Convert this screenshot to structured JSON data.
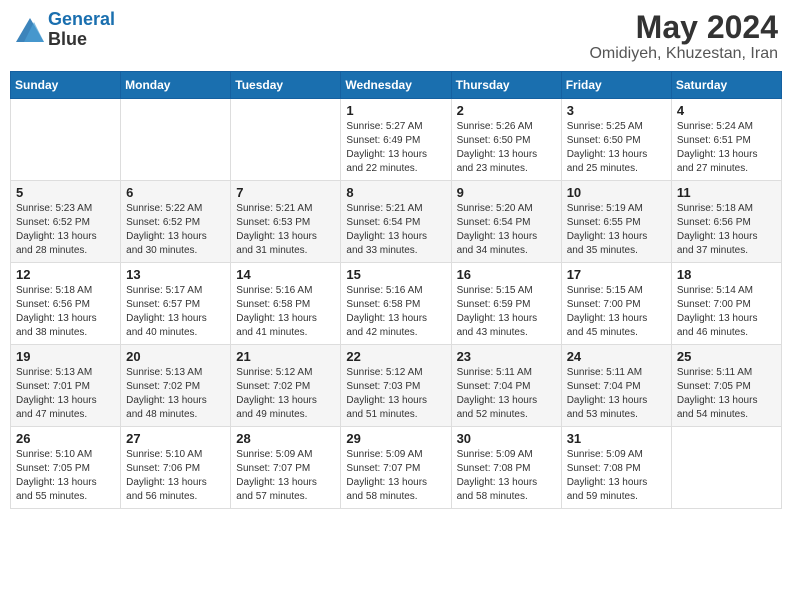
{
  "header": {
    "logo_line1": "General",
    "logo_line2": "Blue",
    "month_year": "May 2024",
    "location": "Omidiyeh, Khuzestan, Iran"
  },
  "weekdays": [
    "Sunday",
    "Monday",
    "Tuesday",
    "Wednesday",
    "Thursday",
    "Friday",
    "Saturday"
  ],
  "weeks": [
    [
      {
        "day": "",
        "sunrise": "",
        "sunset": "",
        "daylight": ""
      },
      {
        "day": "",
        "sunrise": "",
        "sunset": "",
        "daylight": ""
      },
      {
        "day": "",
        "sunrise": "",
        "sunset": "",
        "daylight": ""
      },
      {
        "day": "1",
        "sunrise": "Sunrise: 5:27 AM",
        "sunset": "Sunset: 6:49 PM",
        "daylight": "Daylight: 13 hours and 22 minutes."
      },
      {
        "day": "2",
        "sunrise": "Sunrise: 5:26 AM",
        "sunset": "Sunset: 6:50 PM",
        "daylight": "Daylight: 13 hours and 23 minutes."
      },
      {
        "day": "3",
        "sunrise": "Sunrise: 5:25 AM",
        "sunset": "Sunset: 6:50 PM",
        "daylight": "Daylight: 13 hours and 25 minutes."
      },
      {
        "day": "4",
        "sunrise": "Sunrise: 5:24 AM",
        "sunset": "Sunset: 6:51 PM",
        "daylight": "Daylight: 13 hours and 27 minutes."
      }
    ],
    [
      {
        "day": "5",
        "sunrise": "Sunrise: 5:23 AM",
        "sunset": "Sunset: 6:52 PM",
        "daylight": "Daylight: 13 hours and 28 minutes."
      },
      {
        "day": "6",
        "sunrise": "Sunrise: 5:22 AM",
        "sunset": "Sunset: 6:52 PM",
        "daylight": "Daylight: 13 hours and 30 minutes."
      },
      {
        "day": "7",
        "sunrise": "Sunrise: 5:21 AM",
        "sunset": "Sunset: 6:53 PM",
        "daylight": "Daylight: 13 hours and 31 minutes."
      },
      {
        "day": "8",
        "sunrise": "Sunrise: 5:21 AM",
        "sunset": "Sunset: 6:54 PM",
        "daylight": "Daylight: 13 hours and 33 minutes."
      },
      {
        "day": "9",
        "sunrise": "Sunrise: 5:20 AM",
        "sunset": "Sunset: 6:54 PM",
        "daylight": "Daylight: 13 hours and 34 minutes."
      },
      {
        "day": "10",
        "sunrise": "Sunrise: 5:19 AM",
        "sunset": "Sunset: 6:55 PM",
        "daylight": "Daylight: 13 hours and 35 minutes."
      },
      {
        "day": "11",
        "sunrise": "Sunrise: 5:18 AM",
        "sunset": "Sunset: 6:56 PM",
        "daylight": "Daylight: 13 hours and 37 minutes."
      }
    ],
    [
      {
        "day": "12",
        "sunrise": "Sunrise: 5:18 AM",
        "sunset": "Sunset: 6:56 PM",
        "daylight": "Daylight: 13 hours and 38 minutes."
      },
      {
        "day": "13",
        "sunrise": "Sunrise: 5:17 AM",
        "sunset": "Sunset: 6:57 PM",
        "daylight": "Daylight: 13 hours and 40 minutes."
      },
      {
        "day": "14",
        "sunrise": "Sunrise: 5:16 AM",
        "sunset": "Sunset: 6:58 PM",
        "daylight": "Daylight: 13 hours and 41 minutes."
      },
      {
        "day": "15",
        "sunrise": "Sunrise: 5:16 AM",
        "sunset": "Sunset: 6:58 PM",
        "daylight": "Daylight: 13 hours and 42 minutes."
      },
      {
        "day": "16",
        "sunrise": "Sunrise: 5:15 AM",
        "sunset": "Sunset: 6:59 PM",
        "daylight": "Daylight: 13 hours and 43 minutes."
      },
      {
        "day": "17",
        "sunrise": "Sunrise: 5:15 AM",
        "sunset": "Sunset: 7:00 PM",
        "daylight": "Daylight: 13 hours and 45 minutes."
      },
      {
        "day": "18",
        "sunrise": "Sunrise: 5:14 AM",
        "sunset": "Sunset: 7:00 PM",
        "daylight": "Daylight: 13 hours and 46 minutes."
      }
    ],
    [
      {
        "day": "19",
        "sunrise": "Sunrise: 5:13 AM",
        "sunset": "Sunset: 7:01 PM",
        "daylight": "Daylight: 13 hours and 47 minutes."
      },
      {
        "day": "20",
        "sunrise": "Sunrise: 5:13 AM",
        "sunset": "Sunset: 7:02 PM",
        "daylight": "Daylight: 13 hours and 48 minutes."
      },
      {
        "day": "21",
        "sunrise": "Sunrise: 5:12 AM",
        "sunset": "Sunset: 7:02 PM",
        "daylight": "Daylight: 13 hours and 49 minutes."
      },
      {
        "day": "22",
        "sunrise": "Sunrise: 5:12 AM",
        "sunset": "Sunset: 7:03 PM",
        "daylight": "Daylight: 13 hours and 51 minutes."
      },
      {
        "day": "23",
        "sunrise": "Sunrise: 5:11 AM",
        "sunset": "Sunset: 7:04 PM",
        "daylight": "Daylight: 13 hours and 52 minutes."
      },
      {
        "day": "24",
        "sunrise": "Sunrise: 5:11 AM",
        "sunset": "Sunset: 7:04 PM",
        "daylight": "Daylight: 13 hours and 53 minutes."
      },
      {
        "day": "25",
        "sunrise": "Sunrise: 5:11 AM",
        "sunset": "Sunset: 7:05 PM",
        "daylight": "Daylight: 13 hours and 54 minutes."
      }
    ],
    [
      {
        "day": "26",
        "sunrise": "Sunrise: 5:10 AM",
        "sunset": "Sunset: 7:05 PM",
        "daylight": "Daylight: 13 hours and 55 minutes."
      },
      {
        "day": "27",
        "sunrise": "Sunrise: 5:10 AM",
        "sunset": "Sunset: 7:06 PM",
        "daylight": "Daylight: 13 hours and 56 minutes."
      },
      {
        "day": "28",
        "sunrise": "Sunrise: 5:09 AM",
        "sunset": "Sunset: 7:07 PM",
        "daylight": "Daylight: 13 hours and 57 minutes."
      },
      {
        "day": "29",
        "sunrise": "Sunrise: 5:09 AM",
        "sunset": "Sunset: 7:07 PM",
        "daylight": "Daylight: 13 hours and 58 minutes."
      },
      {
        "day": "30",
        "sunrise": "Sunrise: 5:09 AM",
        "sunset": "Sunset: 7:08 PM",
        "daylight": "Daylight: 13 hours and 58 minutes."
      },
      {
        "day": "31",
        "sunrise": "Sunrise: 5:09 AM",
        "sunset": "Sunset: 7:08 PM",
        "daylight": "Daylight: 13 hours and 59 minutes."
      },
      {
        "day": "",
        "sunrise": "",
        "sunset": "",
        "daylight": ""
      }
    ]
  ]
}
